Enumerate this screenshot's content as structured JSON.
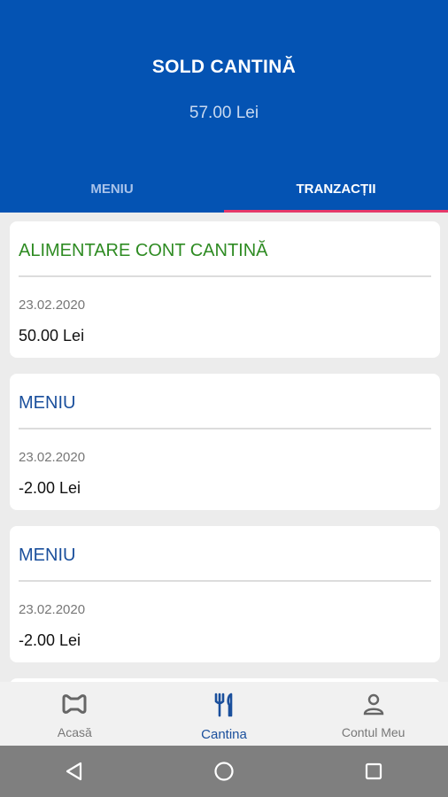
{
  "header": {
    "title": "SOLD CANTINĂ",
    "balance": "57.00 Lei"
  },
  "tabs": [
    {
      "label": "MENIU",
      "active": false
    },
    {
      "label": "TRANZACȚII",
      "active": true
    }
  ],
  "transactions": [
    {
      "title": "ALIMENTARE CONT CANTINĂ",
      "date": "23.02.2020",
      "amount": "50.00 Lei",
      "color": "#2e8b22"
    },
    {
      "title": "MENIU",
      "date": "23.02.2020",
      "amount": "-2.00 Lei",
      "color": "#1a4f9c"
    },
    {
      "title": "MENIU",
      "date": "23.02.2020",
      "amount": "-2.00 Lei",
      "color": "#1a4f9c"
    }
  ],
  "bottom_nav": [
    {
      "label": "Acasă",
      "icon": "home-icon",
      "active": false
    },
    {
      "label": "Cantina",
      "icon": "fork-knife-icon",
      "active": true
    },
    {
      "label": "Contul Meu",
      "icon": "person-icon",
      "active": false
    }
  ],
  "system_nav": {
    "icons": [
      "back-icon",
      "home-circle-icon",
      "recents-icon"
    ]
  },
  "colors": {
    "header_bg": "#0453b3",
    "tab_indicator": "#e5386a",
    "credit": "#2e8b22",
    "debit": "#1a4f9c"
  }
}
